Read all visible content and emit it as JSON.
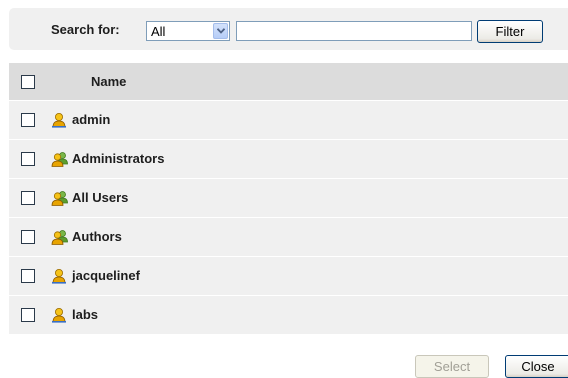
{
  "search": {
    "label": "Search for:",
    "scope_selected": "All",
    "query_value": "",
    "filter_label": "Filter"
  },
  "table": {
    "header_name": "Name",
    "rows": [
      {
        "name": "admin",
        "type": "user",
        "checked": false
      },
      {
        "name": "Administrators",
        "type": "group",
        "checked": false
      },
      {
        "name": "All Users",
        "type": "group",
        "checked": false
      },
      {
        "name": "Authors",
        "type": "group",
        "checked": false
      },
      {
        "name": "jacquelinef",
        "type": "user",
        "checked": false
      },
      {
        "name": "labs",
        "type": "user",
        "checked": false
      }
    ]
  },
  "footer": {
    "select_label": "Select",
    "close_label": "Close"
  },
  "colors": {
    "panel_bg": "#f0f0f0",
    "header_bg": "#dcdcdc",
    "user_icon": "#e8b000",
    "group_icon_secondary": "#7ab648"
  }
}
